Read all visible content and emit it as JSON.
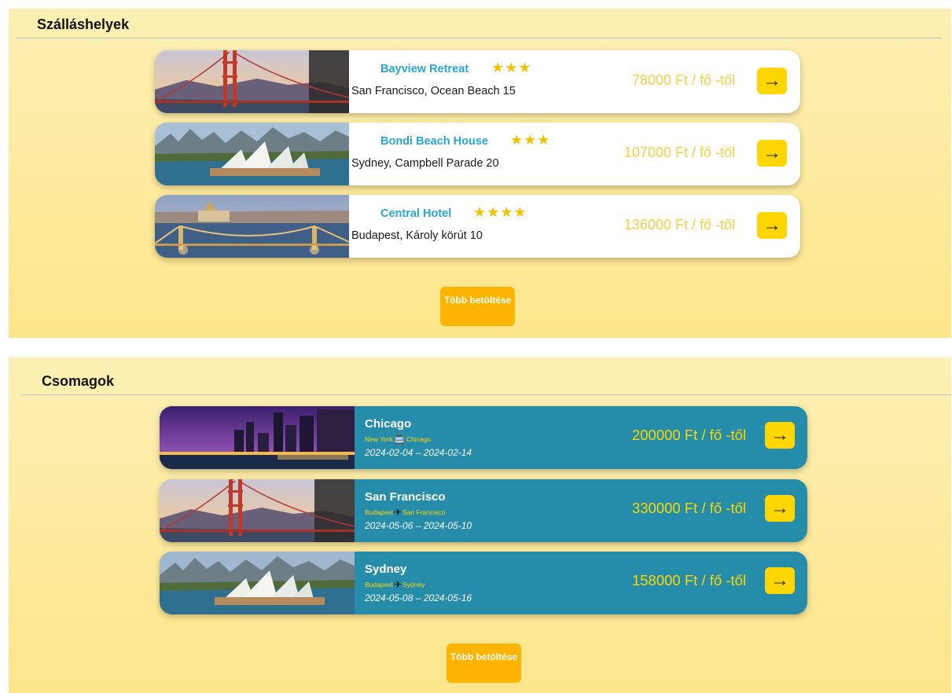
{
  "accommodations": {
    "title": "Szálláshelyek",
    "items": [
      {
        "name": "Bayview Retreat",
        "stars": "★★★",
        "address": "San Francisco, Ocean Beach 15",
        "price": "78000 Ft / fő -től",
        "image": "golden-gate-bridge"
      },
      {
        "name": "Bondi Beach House",
        "stars": "★★★",
        "address": "Sydney, Campbell Parade 20",
        "price": "107000 Ft / fő -től",
        "image": "sydney-opera-house"
      },
      {
        "name": "Central Hotel",
        "stars": "★★★★",
        "address": "Budapest, Károly körút 10",
        "price": "136000 Ft / fő -től",
        "image": "budapest-chain-bridge"
      }
    ],
    "more_label": "Több betöltése"
  },
  "packages": {
    "title": "Csomagok",
    "items": [
      {
        "city": "Chicago",
        "from": "New York",
        "to": "Chicago",
        "transport": "bus-icon",
        "dates": "2024-02-04 – 2024-02-14",
        "price": "200000 Ft / fő -től",
        "image": "chicago-skyline"
      },
      {
        "city": "San Francisco",
        "from": "Budapest",
        "to": "San Francisco",
        "transport": "plane-icon",
        "dates": "2024-05-06 – 2024-05-10",
        "price": "330000 Ft / fő -től",
        "image": "golden-gate-bridge"
      },
      {
        "city": "Sydney",
        "from": "Budapest",
        "to": "Sydney",
        "transport": "plane-icon",
        "dates": "2024-05-08 – 2024-05-16",
        "price": "158000 Ft / fő -től",
        "image": "sydney-opera-house"
      }
    ],
    "more_label": "Több betöltése"
  },
  "icons": {
    "arrow": "→",
    "bus": "🚍",
    "plane": "✈"
  },
  "colors": {
    "accent_yellow": "#ffd600",
    "button_orange": "#ffb400",
    "package_card": "#258da9",
    "hotel_name": "#2aa6d6",
    "price_yellow": "#f5cf45"
  }
}
